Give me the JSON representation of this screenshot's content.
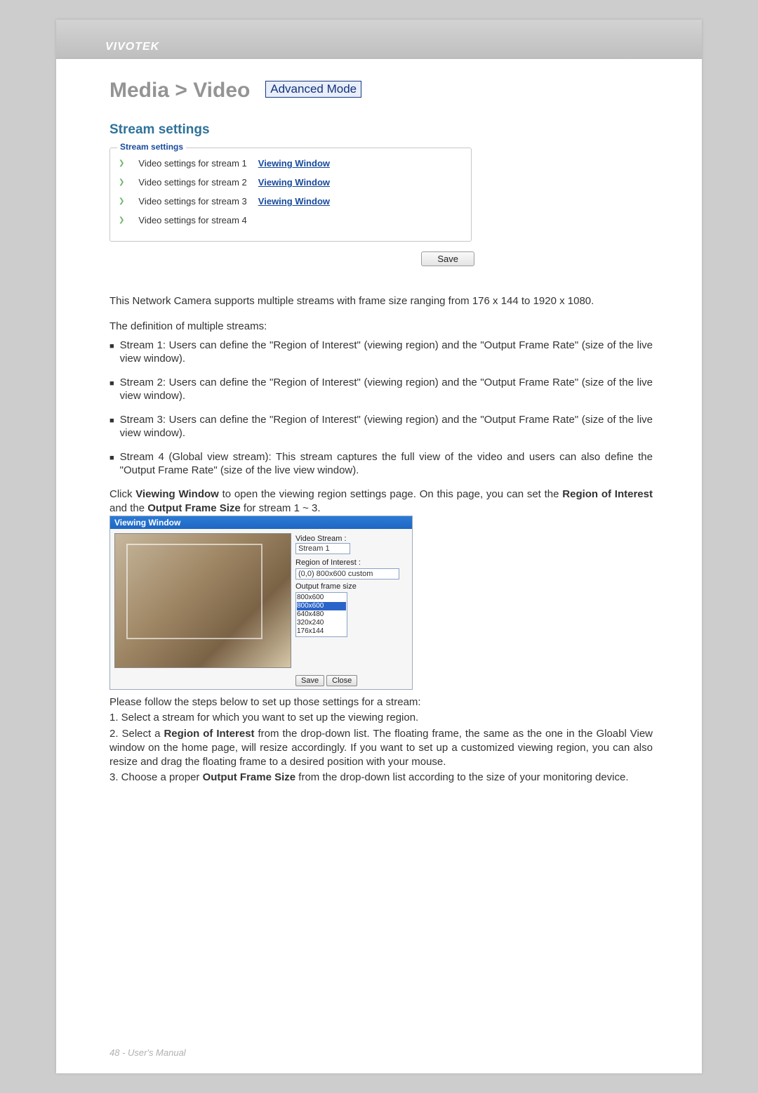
{
  "header": {
    "brand": "VIVOTEK"
  },
  "breadcrumb": "Media > Video",
  "mode_badge": "Advanced Mode",
  "section_title": "Stream settings",
  "panel_legend": "Stream settings",
  "stream_rows": [
    {
      "label": "Video settings for stream 1",
      "link": "Viewing Window"
    },
    {
      "label": "Video settings for stream 2",
      "link": "Viewing Window"
    },
    {
      "label": "Video settings for stream 3",
      "link": "Viewing Window"
    },
    {
      "label": "Video settings for stream 4",
      "link": ""
    }
  ],
  "save_label": "Save",
  "intro_para": "This Network Camera supports multiple streams with frame size ranging from 176 x 144 to 1920 x 1080.",
  "def_heading": "The definition of multiple streams:",
  "def_bullets": [
    "Stream 1: Users can define the \"Region of Interest\" (viewing region) and the \"Output Frame Rate\" (size of the live view window).",
    "Stream 2: Users can define the \"Region of Interest\" (viewing region) and the \"Output Frame Rate\" (size of the live view window).",
    "Stream 3: Users can define the \"Region of Interest\" (viewing region) and the \"Output Frame Rate\" (size of the live view window).",
    "Stream 4 (Global view stream): This stream captures the full view of the video and users can also define the \"Output Frame Rate\" (size of the live view window)."
  ],
  "click_prefix": "Click ",
  "click_bold1": "Viewing Window",
  "click_mid": " to open the viewing region settings page. On this page, you can set the ",
  "click_bold2": "Region of Interest",
  "click_mid2": " and the ",
  "click_bold3": "Output Frame Size",
  "click_suffix": " for stream 1 ~ 3.",
  "vw_window": {
    "title": "Viewing Window",
    "video_stream_label": "Video Stream :",
    "video_stream_value": "Stream 1",
    "roi_label": "Region of Interest :",
    "roi_value": "(0,0) 800x600 custom",
    "ofs_label": "Output frame size",
    "sizes": [
      "800x600",
      "800x600",
      "640x480",
      "320x240",
      "176x144"
    ],
    "save": "Save",
    "close": "Close"
  },
  "steps_intro": "Please follow the steps below to set up those settings for a stream:",
  "step1": "1. Select a stream for which you want to set up the viewing region.",
  "step2_pre": "2. Select a ",
  "step2_bold": "Region of Interest",
  "step2_post": " from the drop-down list. The floating frame, the same as the one in the Gloabl View window on the home page, will resize accordingly. If you want to set up a customized viewing region, you can also resize and drag the floating frame to a desired position with your mouse.",
  "step3_pre": "3. Choose a proper ",
  "step3_bold": "Output Frame Size",
  "step3_post": " from the drop-down list according to the size of your monitoring device.",
  "footer": "48 - User's Manual"
}
